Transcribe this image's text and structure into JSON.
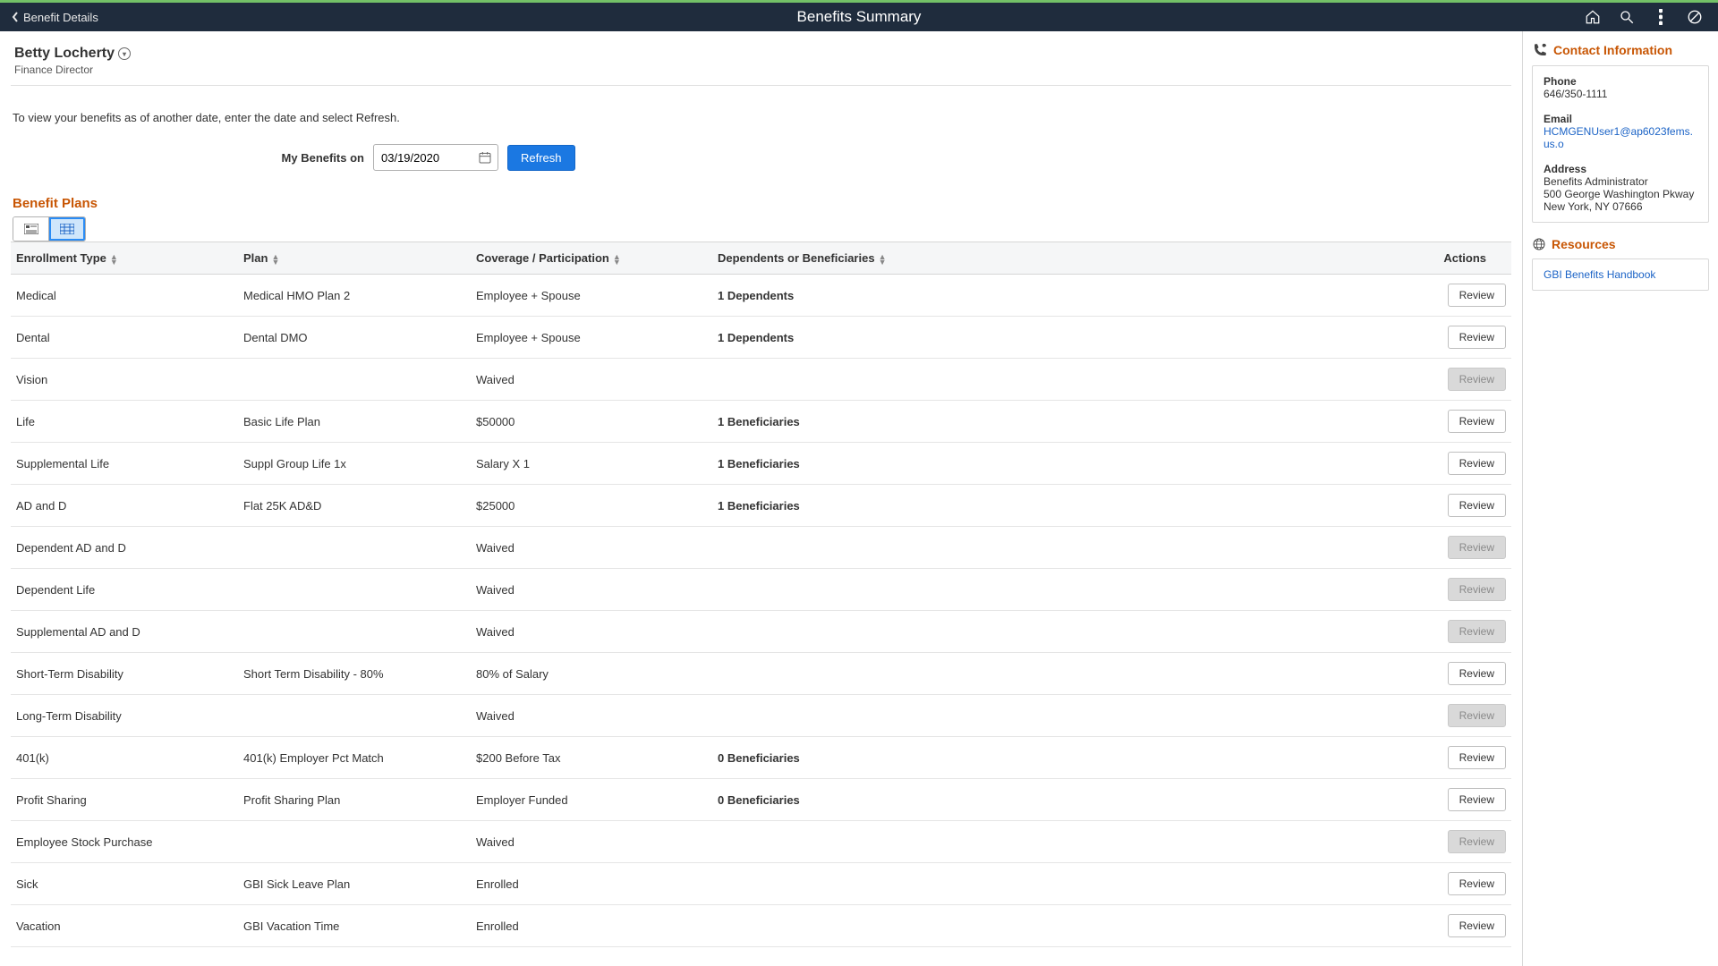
{
  "header": {
    "back_label": "Benefit Details",
    "title": "Benefits Summary"
  },
  "person": {
    "name": "Betty Locherty",
    "title": "Finance Director"
  },
  "instruction": "To view your benefits as of another date, enter the date and select Refresh.",
  "date_section": {
    "label": "My Benefits on",
    "value": "03/19/2020",
    "refresh_label": "Refresh"
  },
  "section_title": "Benefit Plans",
  "columns": {
    "enrollment": "Enrollment Type",
    "plan": "Plan",
    "coverage": "Coverage / Participation",
    "dependents": "Dependents or Beneficiaries",
    "actions": "Actions"
  },
  "review_label": "Review",
  "rows": [
    {
      "enrollment": "Medical",
      "plan": "Medical HMO Plan 2",
      "coverage": "Employee + Spouse",
      "dep": "1 Dependents",
      "enabled": true
    },
    {
      "enrollment": "Dental",
      "plan": "Dental DMO",
      "coverage": "Employee + Spouse",
      "dep": "1 Dependents",
      "enabled": true
    },
    {
      "enrollment": "Vision",
      "plan": "",
      "coverage": "Waived",
      "dep": "",
      "enabled": false
    },
    {
      "enrollment": "Life",
      "plan": "Basic Life Plan",
      "coverage": "$50000",
      "dep": "1 Beneficiaries",
      "enabled": true
    },
    {
      "enrollment": "Supplemental Life",
      "plan": "Suppl Group Life 1x",
      "coverage": "Salary X 1",
      "dep": "1 Beneficiaries",
      "enabled": true
    },
    {
      "enrollment": "AD and D",
      "plan": "Flat 25K AD&D",
      "coverage": "$25000",
      "dep": "1 Beneficiaries",
      "enabled": true
    },
    {
      "enrollment": "Dependent AD and D",
      "plan": "",
      "coverage": "Waived",
      "dep": "",
      "enabled": false
    },
    {
      "enrollment": "Dependent Life",
      "plan": "",
      "coverage": "Waived",
      "dep": "",
      "enabled": false
    },
    {
      "enrollment": "Supplemental AD and D",
      "plan": "",
      "coverage": "Waived",
      "dep": "",
      "enabled": false
    },
    {
      "enrollment": "Short-Term Disability",
      "plan": "Short Term Disability - 80%",
      "coverage": "80% of Salary",
      "dep": "",
      "enabled": true
    },
    {
      "enrollment": "Long-Term Disability",
      "plan": "",
      "coverage": "Waived",
      "dep": "",
      "enabled": false
    },
    {
      "enrollment": "401(k)",
      "plan": "401(k) Employer Pct Match",
      "coverage": "$200 Before Tax",
      "dep": "0 Beneficiaries",
      "enabled": true
    },
    {
      "enrollment": "Profit Sharing",
      "plan": "Profit Sharing Plan",
      "coverage": "Employer Funded",
      "dep": "0 Beneficiaries",
      "enabled": true
    },
    {
      "enrollment": "Employee Stock Purchase",
      "plan": "",
      "coverage": "Waived",
      "dep": "",
      "enabled": false
    },
    {
      "enrollment": "Sick",
      "plan": "GBI Sick Leave Plan",
      "coverage": "Enrolled",
      "dep": "",
      "enabled": true
    },
    {
      "enrollment": "Vacation",
      "plan": "GBI Vacation Time",
      "coverage": "Enrolled",
      "dep": "",
      "enabled": true
    }
  ],
  "contact": {
    "title": "Contact Information",
    "phone_label": "Phone",
    "phone_value": "646/350-1111",
    "email_label": "Email",
    "email_value": "HCMGENUser1@ap6023fems.us.o",
    "address_label": "Address",
    "address_line1": "Benefits Administrator",
    "address_line2": "500 George Washington Pkway",
    "address_line3": "New York, NY 07666"
  },
  "resources": {
    "title": "Resources",
    "link1": "GBI Benefits Handbook"
  }
}
